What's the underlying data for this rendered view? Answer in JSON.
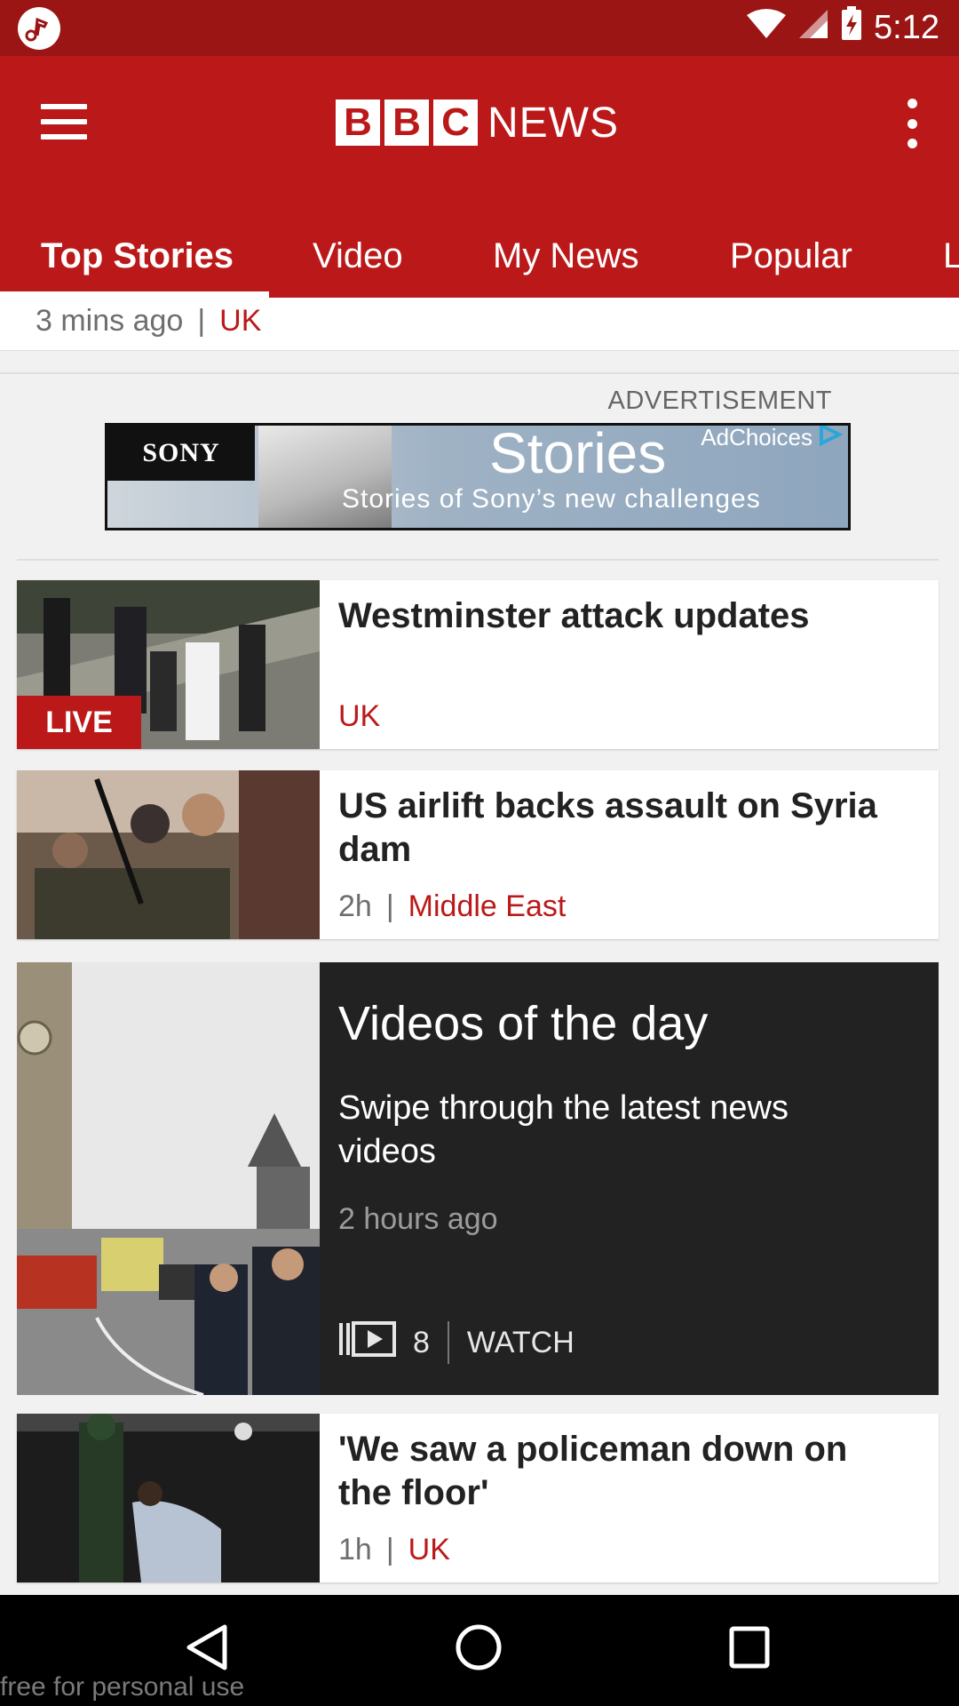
{
  "status_bar": {
    "time": "5:12",
    "icons": [
      "music-app-icon",
      "wifi-icon",
      "cell-signal-icon",
      "battery-charging-icon"
    ]
  },
  "app_bar": {
    "logo_letters": [
      "B",
      "B",
      "C"
    ],
    "logo_word": "NEWS",
    "tabs": [
      {
        "label": "Top Stories",
        "selected": true
      },
      {
        "label": "Video",
        "selected": false
      },
      {
        "label": "My News",
        "selected": false
      },
      {
        "label": "Popular",
        "selected": false
      },
      {
        "label": "L",
        "selected": false
      }
    ],
    "colors": {
      "brand_red": "#bb1919",
      "status_red": "#9b1515"
    }
  },
  "previous_card": {
    "time": "3 mins ago",
    "separator": "|",
    "category": "UK"
  },
  "advertisement": {
    "label": "ADVERTISEMENT",
    "brand": "SONY",
    "headline": "Stories",
    "tagline": "Stories of Sony’s new challenges",
    "adchoices": "AdChoices"
  },
  "stories": [
    {
      "headline": "Westminster attack updates",
      "time": "",
      "category": "UK",
      "badge": "LIVE"
    },
    {
      "headline": "US airlift backs assault on Syria dam",
      "time": "2h",
      "separator": "|",
      "category": "Middle East"
    },
    {
      "headline": "'We saw a policeman down on the floor'",
      "time": "1h",
      "separator": "|",
      "category": "UK"
    }
  ],
  "video_promo": {
    "title": "Videos of the day",
    "description": "Swipe through the latest news videos",
    "time": "2 hours ago",
    "count": "8",
    "action": "WATCH"
  },
  "watermark": "free for personal use"
}
